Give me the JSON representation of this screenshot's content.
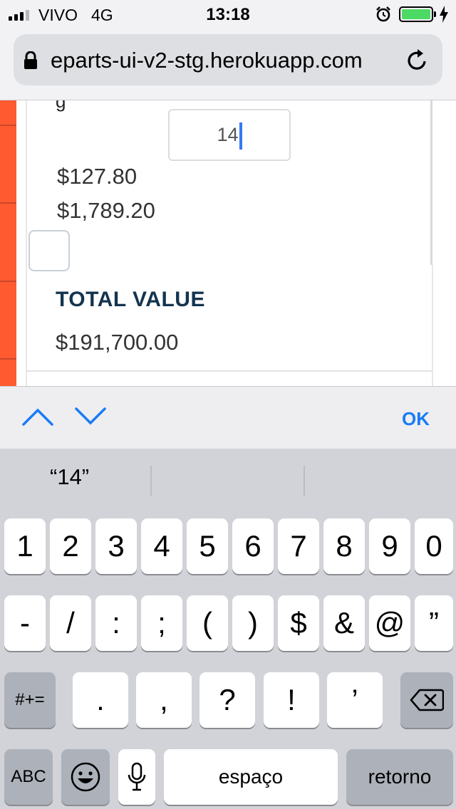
{
  "status_bar": {
    "carrier": "VIVO",
    "network": "4G",
    "time": "13:18"
  },
  "browser": {
    "url": "eparts-ui-v2-stg.herokuapp.com"
  },
  "page": {
    "cut_text": "g",
    "quantity_value": "14",
    "price_unit": "$127.80",
    "price_line_total": "$1,789.20",
    "checkbox_checked": false,
    "total_label": "TOTAL VALUE",
    "total_value": "$191,700.00"
  },
  "accessory_bar": {
    "done_label": "OK"
  },
  "keyboard": {
    "suggestion": "“14”",
    "row1": [
      "1",
      "2",
      "3",
      "4",
      "5",
      "6",
      "7",
      "8",
      "9",
      "0"
    ],
    "row2": [
      "-",
      "/",
      ":",
      ";",
      "(",
      ")",
      "$",
      "&",
      "@",
      "”"
    ],
    "row3": [
      ".",
      ",",
      "?",
      "!",
      "’"
    ],
    "symbols_key": "#+=",
    "abc_key": "ABC",
    "space_key": "espaço",
    "return_key": "retorno"
  }
}
